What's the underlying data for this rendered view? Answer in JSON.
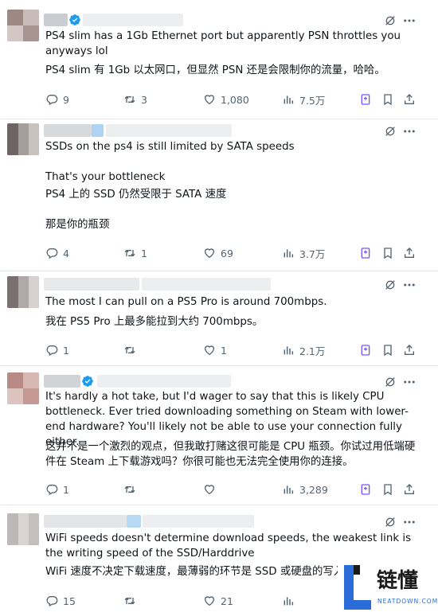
{
  "tweets": [
    {
      "text_en": "PS4 slim has a 1Gb Ethernet port but apparently PSN throttles you anyways lol",
      "text_zh": "PS4 slim 有 1Gb 以太网口，但显然 PSN 还是会限制你的流量，哈哈。",
      "verified": true,
      "replies": "9",
      "retweets": "3",
      "likes": "1,080",
      "views": "7.5万"
    },
    {
      "text_en": "SSDs on the ps4 is still limited by SATA speeds\n\nThat's your bottleneck",
      "text_zh": "PS4 上的 SSD 仍然受限于 SATA 速度\n\n那是你的瓶颈",
      "verified": false,
      "replies": "4",
      "retweets": "1",
      "likes": "69",
      "views": "3.7万"
    },
    {
      "text_en": "The most I can pull on a PS5 Pro is around 700mbps.",
      "text_zh": "我在 PS5 Pro 上最多能拉到大约 700mbps。",
      "verified": false,
      "replies": "1",
      "retweets": "",
      "likes": "1",
      "views": "2.1万"
    },
    {
      "text_en": "It's hardly a hot take, but I'd wager to say that this is likely CPU bottleneck. Ever tried downloading something on Steam with lower-end hardware? You'll likely not be able to use your connection fully either.",
      "text_zh": "这并不是一个激烈的观点，但我敢打赌这很可能是 CPU 瓶颈。你试过用低端硬件在 Steam 上下载游戏吗？你很可能也无法完全使用你的连接。",
      "verified": true,
      "replies": "1",
      "retweets": "",
      "likes": "",
      "views": "3,289"
    },
    {
      "text_en": "WiFi speeds doesn't determine download speeds, the weakest link is the writing speed of the SSD/Harddrive",
      "text_zh": "WiFi 速度不决定下载速度，最薄弱的环节是 SSD 或硬盘的写入",
      "verified": false,
      "replies": "15",
      "retweets": "",
      "likes": "21",
      "views": ""
    }
  ],
  "watermark": {
    "brand": "链懂",
    "url": "NEATDOWN.COM",
    "letter": "L"
  },
  "colors": {
    "accent": "#1d9bf0",
    "icon": "#536471",
    "text": "#0f1419",
    "divider": "#e6e9ec",
    "bookmark_accent": "#7856ff"
  },
  "icons": [
    "reply-icon",
    "retweet-icon",
    "like-icon",
    "views-icon",
    "grok-icon",
    "more-icon",
    "bookmark-icon",
    "share-icon",
    "verified-icon"
  ]
}
